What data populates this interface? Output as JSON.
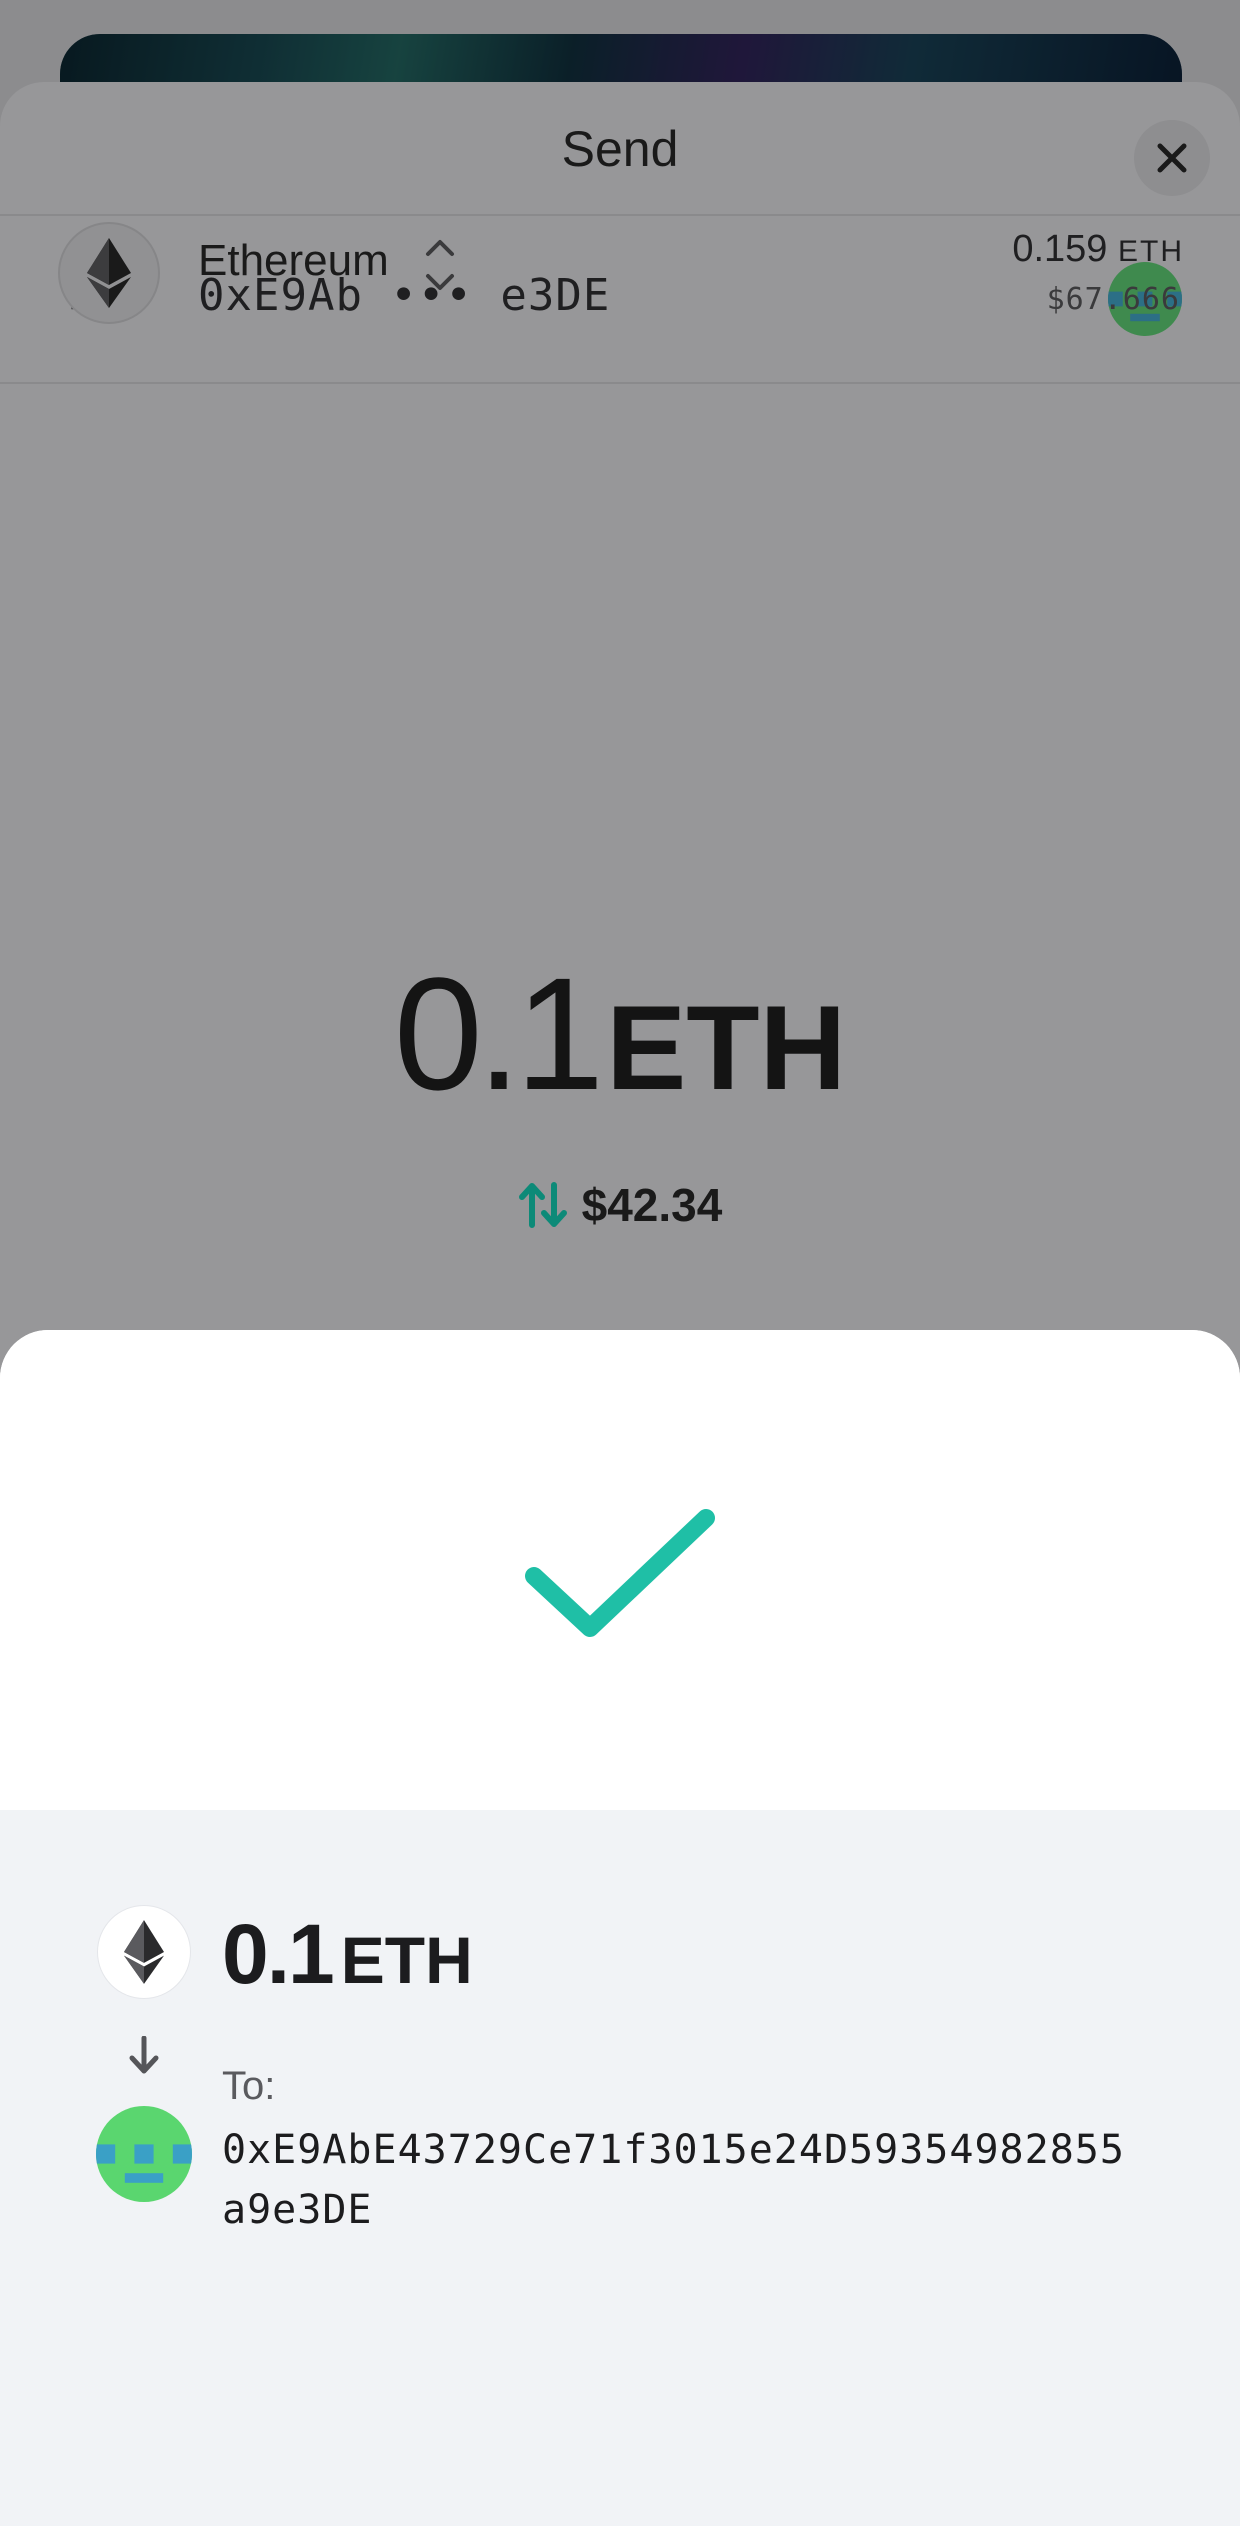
{
  "send_sheet": {
    "title": "Send",
    "to_label": "To:",
    "to_address_short": "0xE9Ab ••• e3DE",
    "asset": {
      "name": "Ethereum",
      "balance": "0.159",
      "balance_unit": "ETH",
      "balance_fiat": "$67.666"
    },
    "amount": {
      "value": "0.1",
      "unit": "ETH"
    },
    "fiat_amount": "$42.34"
  },
  "confirmation": {
    "amount_value": "0.1",
    "amount_unit": "ETH",
    "to_label": "To:",
    "to_address_full": "0xE9AbE43729Ce71f3015e24D59354982855a9e3DE"
  },
  "colors": {
    "accent_green": "#1fbfa6",
    "swap_arrow": "#0d8a78",
    "avatar_green": "#5ad66f",
    "avatar_blue": "#3aa0c6"
  },
  "icons": [
    "close-icon",
    "ethereum-icon",
    "chevron-up-down-icon",
    "swap-arrows-icon",
    "checkmark-icon",
    "arrow-down-icon",
    "wallet-avatar"
  ]
}
